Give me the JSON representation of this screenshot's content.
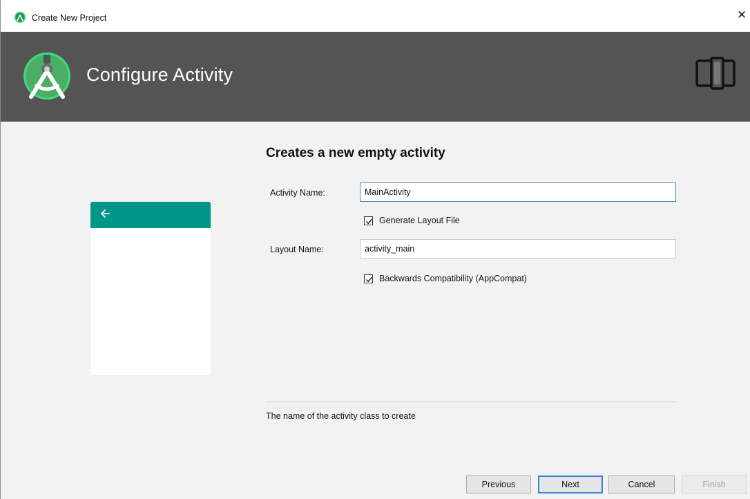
{
  "window": {
    "title": "Create New Project",
    "close_glyph": "✕"
  },
  "header": {
    "heading": "Configure Activity"
  },
  "form": {
    "title": "Creates a new empty activity",
    "activity_name_label": "Activity Name:",
    "activity_name_value": "MainActivity",
    "generate_layout_label": "Generate Layout File",
    "generate_layout_checked": true,
    "layout_name_label": "Layout Name:",
    "layout_name_value": "activity_main",
    "backwards_compat_label": "Backwards Compatibility (AppCompat)",
    "backwards_compat_checked": true,
    "hint": "The name of the activity class to create"
  },
  "buttons": {
    "previous": "Previous",
    "next": "Next",
    "cancel": "Cancel",
    "finish": "Finish"
  },
  "colors": {
    "header_bg": "#545454",
    "preview_appbar": "#009688",
    "android_green": "#3ddc84",
    "focus_blue": "#3c7fd6"
  },
  "icons": {
    "app": "android-studio-icon",
    "logo": "android-studio-logo",
    "device": "phone-tablet-icon",
    "back": "arrow-left-icon",
    "close": "close-icon"
  }
}
